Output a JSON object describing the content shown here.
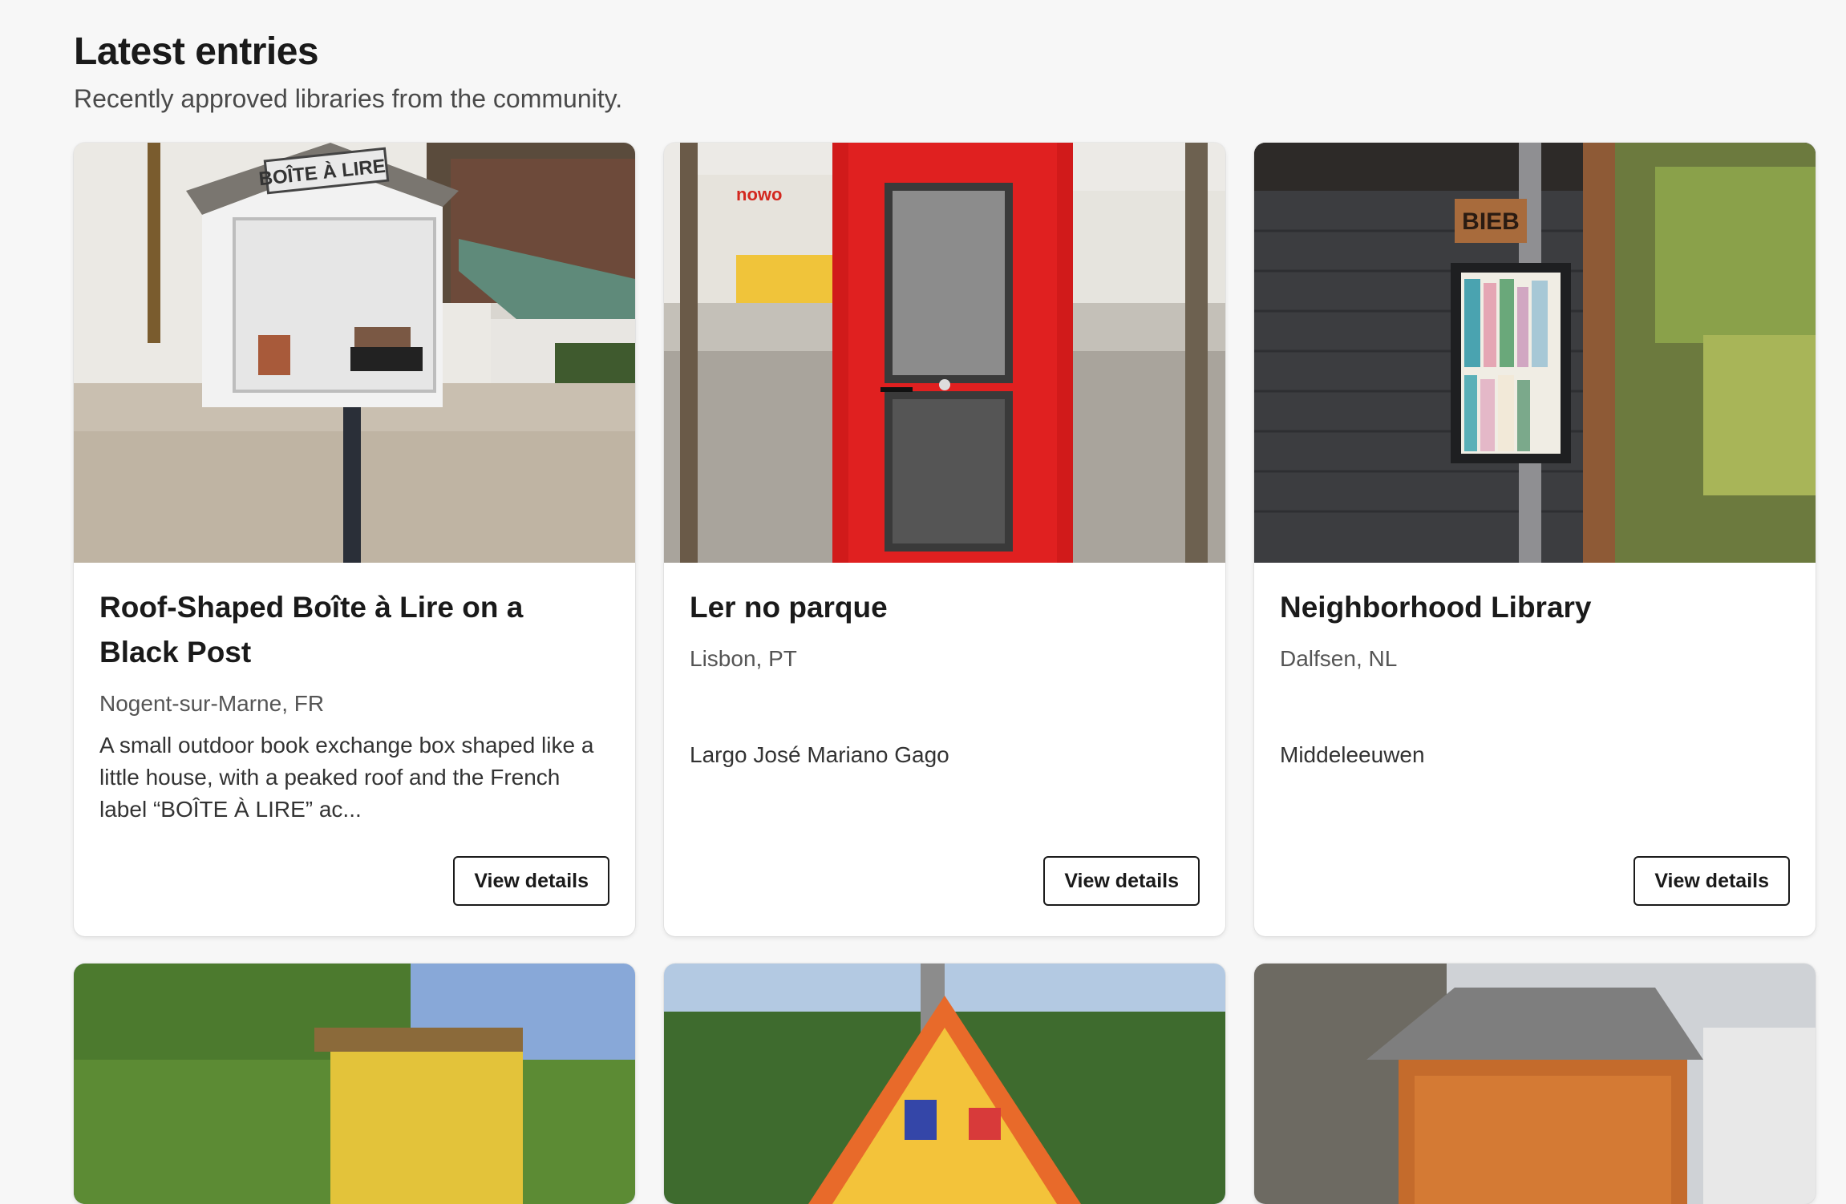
{
  "section": {
    "title": "Latest entries",
    "subtitle": "Recently approved libraries from the community."
  },
  "cards": [
    {
      "title": "Roof-Shaped Boîte à Lire on a Black Post",
      "location": "Nogent-sur-Marne, FR",
      "description": "A small outdoor book exchange box shaped like a little house, with a peaked roof and the French label “BOÎTE À LIRE” ac...",
      "button": "View details",
      "image_text": "BOÎTE À LIRE"
    },
    {
      "title": "Ler no parque",
      "location": "Lisbon, PT",
      "address": "Largo José Mariano Gago",
      "button": "View details",
      "image_text": "nowo"
    },
    {
      "title": "Neighborhood Library",
      "location": "Dalfsen, NL",
      "address": "Middeleeuwen",
      "button": "View details",
      "image_text": "BIEB"
    }
  ],
  "colors": {
    "page_bg": "#f7f7f7",
    "card_bg": "#ffffff",
    "button_border": "#1a1a1a"
  }
}
